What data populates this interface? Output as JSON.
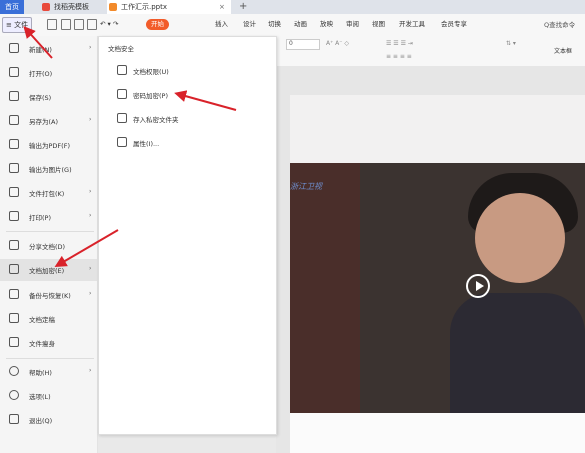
{
  "tabs": {
    "home": "首页",
    "docer": "找稻壳模板",
    "file": "工作汇示.pptx",
    "add": "+"
  },
  "menu": {
    "file_button": "≡ 文件",
    "ribbon_tabs": [
      "开始",
      "插入",
      "设计",
      "切换",
      "动画",
      "放映",
      "审阅",
      "视图",
      "开发工具",
      "会员专享"
    ],
    "search": "Q查找命令",
    "active_tab": "开始",
    "accent_color": "#f25c2a"
  },
  "toolbar": {
    "font_size": "0",
    "right_label": "文本框"
  },
  "file_menu": {
    "items": [
      {
        "label": "新建(N)",
        "icon": "new-doc-icon",
        "arrow": "›"
      },
      {
        "label": "打开(O)",
        "icon": "folder-open-icon"
      },
      {
        "label": "保存(S)",
        "icon": "save-icon"
      },
      {
        "label": "另存为(A)",
        "icon": "save-as-icon",
        "arrow": "›"
      },
      {
        "label": "输出为PDF(F)",
        "icon": "pdf-icon"
      },
      {
        "label": "输出为图片(G)",
        "icon": "image-icon"
      },
      {
        "label": "文件打包(K)",
        "icon": "package-icon",
        "arrow": "›"
      },
      {
        "label": "打印(P)",
        "icon": "print-icon",
        "arrow": "›"
      },
      {
        "label": "分享文档(D)",
        "icon": "share-icon"
      },
      {
        "label": "文档加密(E)",
        "icon": "encrypt-icon",
        "arrow": "›"
      },
      {
        "label": "备份与恢复(K)",
        "icon": "backup-icon",
        "arrow": "›"
      },
      {
        "label": "文档定稿",
        "icon": "finalize-icon"
      },
      {
        "label": "文件瘦身",
        "icon": "slim-icon"
      },
      {
        "label": "帮助(H)",
        "icon": "help-icon",
        "arrow": "›"
      },
      {
        "label": "选项(L)",
        "icon": "options-icon"
      },
      {
        "label": "退出(Q)",
        "icon": "exit-icon"
      }
    ]
  },
  "submenu": {
    "title": "文档安全",
    "items": [
      {
        "label": "文档权限(U)",
        "icon": "doc-permission-icon"
      },
      {
        "label": "密码加密(P)",
        "icon": "password-icon"
      },
      {
        "label": "存入私密文件夹",
        "icon": "private-folder-icon"
      },
      {
        "label": "属性(I)...",
        "icon": "properties-icon"
      }
    ]
  },
  "video": {
    "channel": "浙江卫视"
  }
}
